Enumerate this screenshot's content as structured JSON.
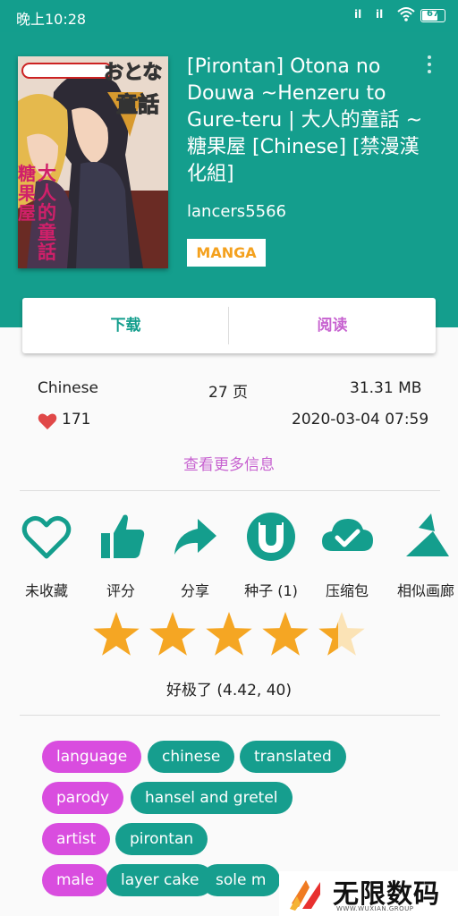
{
  "status_bar": {
    "time": "晚上10:28",
    "signal1": "il",
    "signal2": "il",
    "battery": "67"
  },
  "gallery": {
    "title": "[Pirontan] Otona no Douwa ~Henzeru to Gure-teru | 大人的童話 ~糖果屋 [Chinese] [禁漫漢化組]",
    "uploader": "lancers5566",
    "category": "MANGA",
    "cover_text": [
      "おとな",
      "童話",
      "大人的童話",
      "糖果屋"
    ]
  },
  "actions": {
    "download": "下载",
    "read": "阅读"
  },
  "info": {
    "language": "Chinese",
    "pages": "27 页",
    "size": "31.31 MB",
    "favorites": "171",
    "date": "2020-03-04 07:59",
    "more": "查看更多信息"
  },
  "tools": [
    {
      "icon": "heart-outline-icon",
      "label": "未收藏"
    },
    {
      "icon": "thumbs-up-icon",
      "label": "评分"
    },
    {
      "icon": "share-arrow-icon",
      "label": "分享"
    },
    {
      "icon": "torrent-icon",
      "label": "种子 (1)"
    },
    {
      "icon": "cloud-check-icon",
      "label": "压缩包"
    },
    {
      "icon": "similar-gallery-icon",
      "label": "相似画廊"
    }
  ],
  "rating": {
    "stars": 4.42,
    "max": 5,
    "text": "好极了 (4.42, 40)"
  },
  "tags": [
    {
      "namespace": "language",
      "values": [
        "chinese",
        "translated"
      ]
    },
    {
      "namespace": "parody",
      "values": [
        "hansel and gretel"
      ]
    },
    {
      "namespace": "artist",
      "values": [
        "pirontan"
      ]
    },
    {
      "namespace": "male",
      "values": [
        "layer cake",
        "sole m"
      ]
    }
  ],
  "watermark": {
    "title": "无限数码",
    "subtitle": "WWW.WUXIAN.GROUP"
  },
  "colors": {
    "primary": "#149e8d",
    "accent": "#c762d0",
    "tag_namespace": "#d94ddf",
    "star": "#f5a623",
    "badge": "#f4a11e"
  }
}
